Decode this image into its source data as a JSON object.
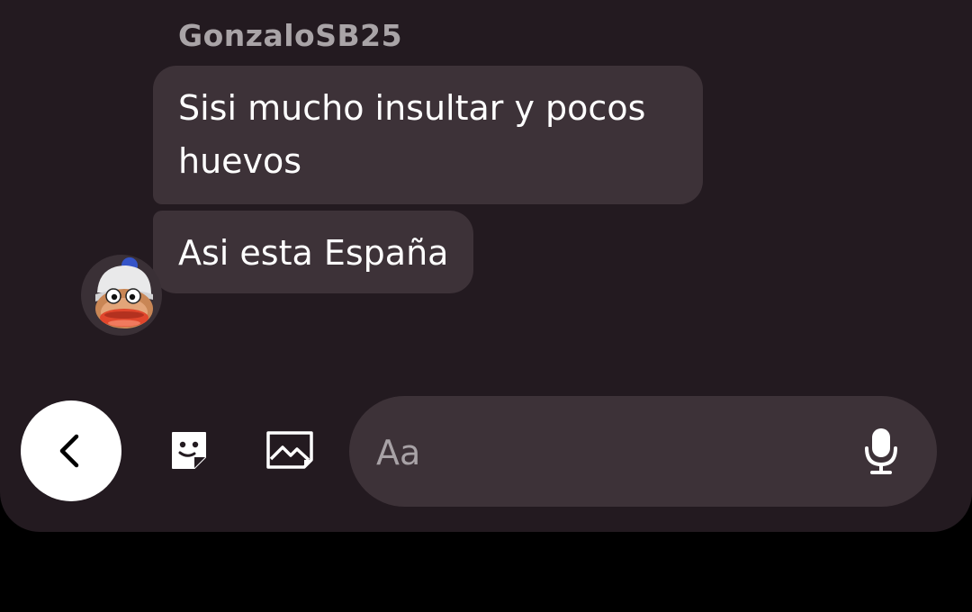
{
  "conversation": {
    "sender_name": "GonzaloSB25",
    "messages": [
      {
        "text": "Sisi mucho insultar y pocos huevos"
      },
      {
        "text": "Asi esta España"
      }
    ]
  },
  "composer": {
    "placeholder": "Aa",
    "back_icon": "chevron-left-icon",
    "sticker_icon": "sticker-icon",
    "image_icon": "image-icon",
    "mic_icon": "microphone-icon"
  },
  "colors": {
    "panel_background": "#231a20",
    "bubble_background": "#3d3238",
    "sender_name": "#a9a4a7",
    "message_text": "#ffffff",
    "placeholder_text": "#a8a2a6",
    "outer_background": "#000000"
  }
}
